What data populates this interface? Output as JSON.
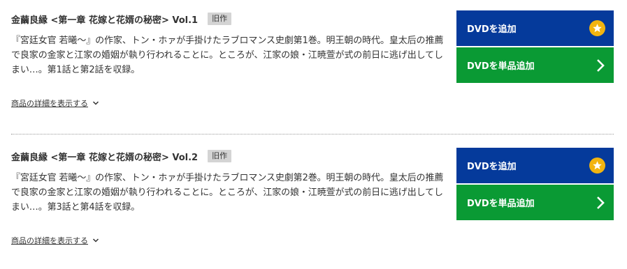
{
  "items": [
    {
      "title": "金繭良縁 <第一章 花嫁と花婿の秘密> Vol.1",
      "badge": "旧作",
      "description": "『宮廷女官 若曦～』の作家、トン・ホァが手掛けたラブロマンス史劇第1巻。明王朝の時代。皇太后の推薦で良家の金家と江家の婚姻が執り行われることに。ところが、江家の娘・江暁萱が式の前日に逃げ出してしまい…。第1話と第2話を収録。",
      "details_link": "商品の詳細を表示する",
      "add_button": "DVDを追加",
      "single_button": "DVDを単品追加"
    },
    {
      "title": "金繭良縁 <第一章 花嫁と花婿の秘密> Vol.2",
      "badge": "旧作",
      "description": "『宮廷女官 若曦～』の作家、トン・ホァが手掛けたラブロマンス史劇第2巻。明王朝の時代。皇太后の推薦で良家の金家と江家の婚姻が執り行われることに。ところが、江家の娘・江暁萱が式の前日に逃げ出してしまい…。第3話と第4話を収録。",
      "details_link": "商品の詳細を表示する",
      "add_button": "DVDを追加",
      "single_button": "DVDを単品追加"
    }
  ],
  "icons": {
    "star": "star-icon",
    "arrow": "chevron-right-icon",
    "chevron_down": "chevron-down-icon"
  },
  "colors": {
    "add_button_bg": "#053a9b",
    "single_button_bg": "#0a9a34",
    "star_bg": "#f2b410",
    "badge_bg": "#d4d4d4"
  }
}
